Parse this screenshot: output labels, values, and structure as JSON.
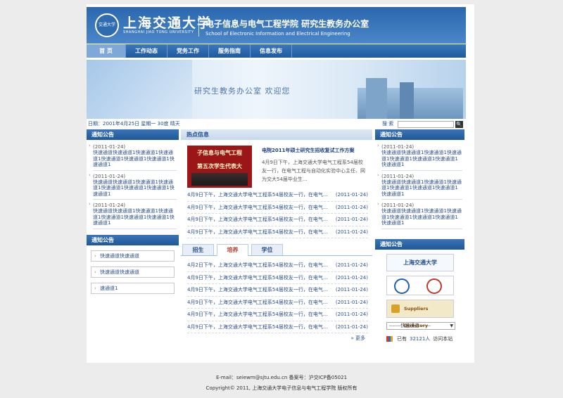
{
  "header": {
    "seal_text": "交通大学",
    "university_cn": "上海交通大学",
    "university_en": "SHANGHAI JIAO TONG UNIVERSITY",
    "school_cn": "电子信息与电气工程学院  研究生教务办公室",
    "school_en": "School of Electronic Information and Electrical Engineering"
  },
  "nav": [
    "首 页",
    "工作动态",
    "党务工作",
    "服务指南",
    "信息发布"
  ],
  "banner": {
    "text": "研究生教务办公室  欢迎您"
  },
  "datebar": {
    "date": "日期：2001年4月25日 星期一 30度 晴天",
    "search_label": "搜 索",
    "search_button": "🔍"
  },
  "left_notice": {
    "title": "通知公告",
    "items": [
      {
        "date": "(2011-01-24)",
        "text": "快速通道快速通道1快速通道1快速通道1快速通道1快速通道1快速通道1快速通道1"
      },
      {
        "date": "(2011-01-24)",
        "text": "快速通道快速通道1快速通道1快速通道1快速通道1快速通道1快速通道1快速通道1"
      },
      {
        "date": "(2011-01-24)",
        "text": "快速通道快速通道1快速通道1快速通道1快速通道1快速通道1快速通道1快速通道1"
      }
    ]
  },
  "left_quick": {
    "title": "通知公告",
    "items": [
      "快速通道快速通道",
      "快速通道快速通道",
      "速通道1"
    ]
  },
  "hot": {
    "title": "热点信息",
    "feature_image_text": [
      "子信息与电气工程",
      "第五次学生代表大"
    ],
    "feature_title": "电院2011年硕士研究生招收复试工作方案",
    "feature_desc": "4月9日下午，上海交通大学电气工程系54届校友一行，在电气工程与自动化实验中心主任、网为交大54届毕业生...",
    "news": [
      {
        "text": "4月9日下午，上海交通大学电气工程系54届校友一行，在电气...",
        "date": "(2011-01-24)"
      },
      {
        "text": "4月9日下午，上海交通大学电气工程系54届校友一行，在电气...",
        "date": "(2011-01-24)"
      },
      {
        "text": "4月9日下午，上海交通大学电气工程系54届校友一行，在电气...",
        "date": "(2011-01-24)"
      },
      {
        "text": "4月9日下午，上海交通大学电气工程系54届校友一行，在电气...",
        "date": "(2011-01-24)"
      }
    ]
  },
  "tabs": [
    "招生",
    "培养",
    "学位"
  ],
  "tab_news": [
    {
      "text": "4月2日下午，上海交通大学电气工程系54届校友一行，在电气...",
      "date": "(2011-01-24)"
    },
    {
      "text": "4月9日下午，上海交通大学电气工程系54届校友一行，在电气...",
      "date": "(2011-01-24)"
    },
    {
      "text": "4月9日下午，上海交通大学电气工程系54届校友一行，在电气...",
      "date": "(2011-01-24)"
    },
    {
      "text": "4月9日下午，上海交通大学电气工程系54届校友一行，在电气...",
      "date": "(2011-01-24)"
    },
    {
      "text": "4月9日下午，上海交通大学电气工程系54届校友一行，在电气...",
      "date": "(2011-01-24)"
    },
    {
      "text": "4月9日下午，上海交通大学电气工程系54届校友一行，在电气...",
      "date": "(2011-01-24)"
    }
  ],
  "more": "» 更多",
  "right_notice": {
    "title": "通知公告",
    "items": [
      {
        "date": "(2011-01-24)",
        "text": "快速通道快速通道1快速通道1快速通道1快速通道1快速通道1快速通道1快速通道1"
      },
      {
        "date": "(2011-01-24)",
        "text": "快速通道快速通道1快速通道1快速通道1快速通道1快速通道1快速通道1快速通道1"
      },
      {
        "date": "(2011-01-24)",
        "text": "快速通道快速通道1快速通道1快速通道1快速通道1快速通道1快速通道1快速通道1"
      }
    ]
  },
  "links": {
    "title": "通知公告",
    "logo1": "上海交通大学",
    "logo3": "Suppliers Directory",
    "select": "-------快速通道-------",
    "visits_prefix": "已有",
    "visits_count": "32121人",
    "visits_suffix": "访问本站"
  },
  "footer": {
    "line1": "E-mail：seiewm@sjtu.edu.cn 备案号：沪交ICP备05021",
    "line2": "Copyright© 2011, 上海交通大学电子信息与电气工程学院  版权所有"
  }
}
